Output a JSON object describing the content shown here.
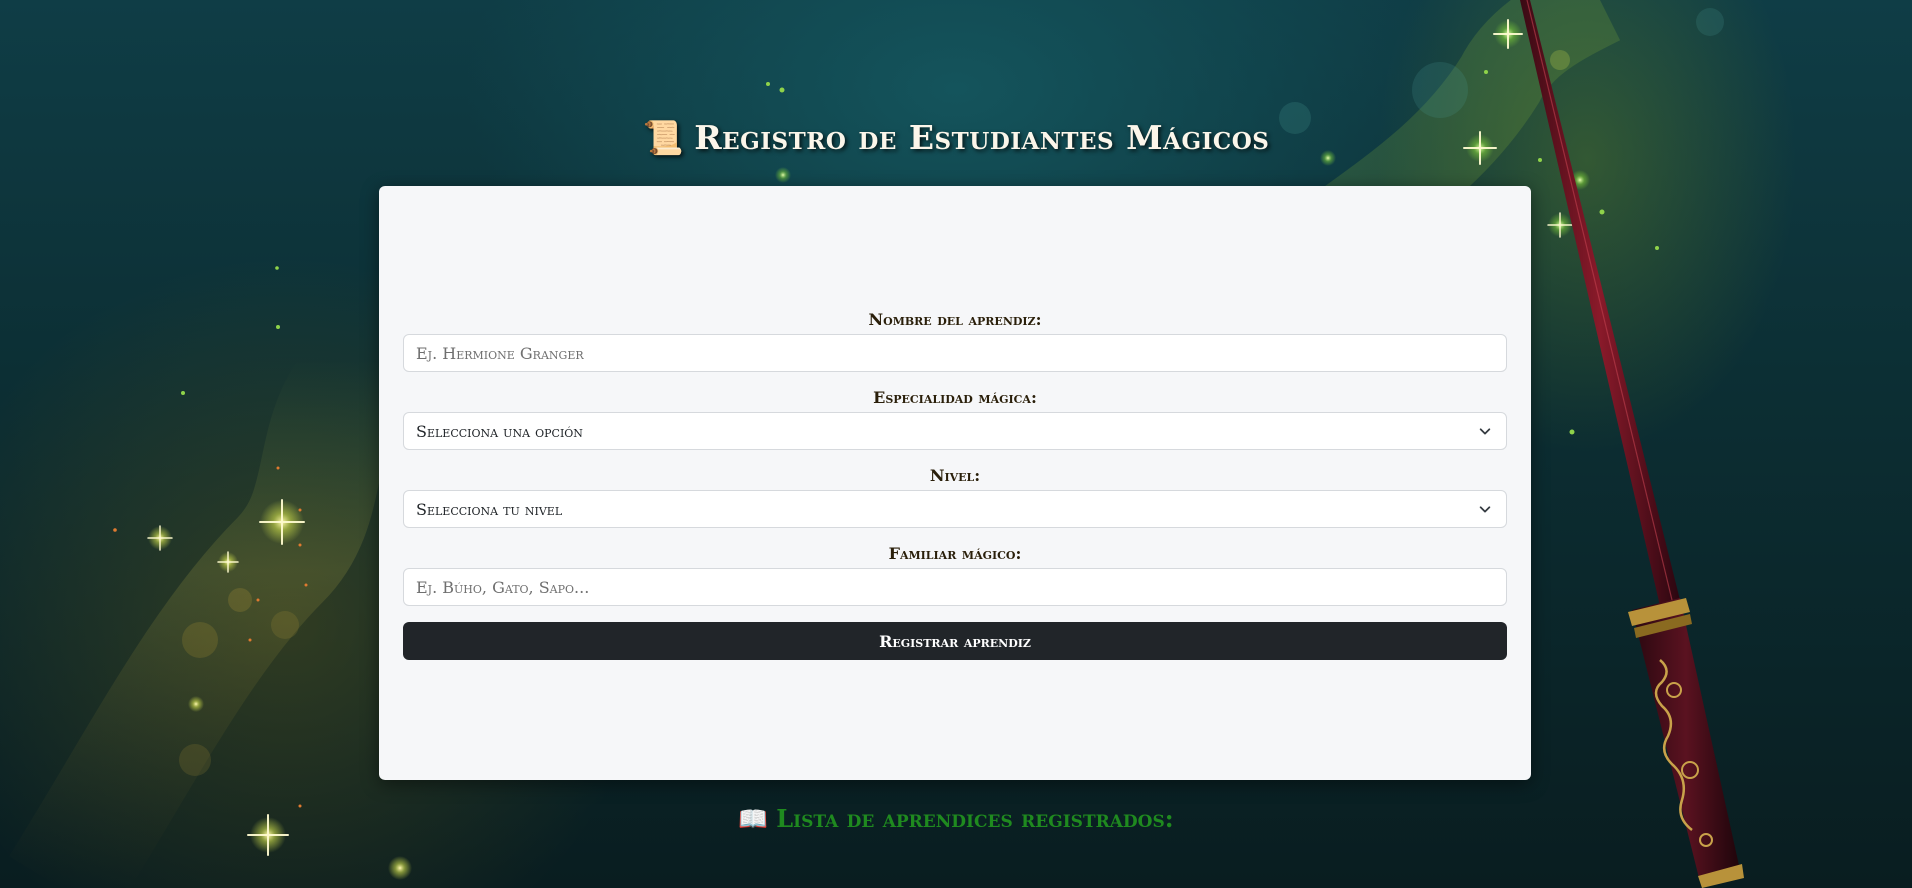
{
  "header": {
    "icon": "scroll-icon",
    "icon_glyph": "📜",
    "title": "Registro de Estudiantes Mágicos"
  },
  "form": {
    "name": {
      "label": "Nombre del aprendiz:",
      "placeholder": "Ej. Hermione Granger",
      "value": ""
    },
    "specialty": {
      "label": "Especialidad mágica:",
      "selected": "Selecciona una opción"
    },
    "level": {
      "label": "Nivel:",
      "selected": "Selecciona tu nivel"
    },
    "familiar": {
      "label": "Familiar mágico:",
      "placeholder": "Ej. Búho, Gato, Sapo...",
      "value": ""
    },
    "submit_label": "Registrar aprendiz"
  },
  "list": {
    "icon": "open-book-icon",
    "icon_glyph": "📖",
    "title": "Lista de aprendices registrados:"
  },
  "colors": {
    "list_title": "#1f8a1f",
    "button_bg": "#212529",
    "card_bg": "#f6f7f9"
  }
}
